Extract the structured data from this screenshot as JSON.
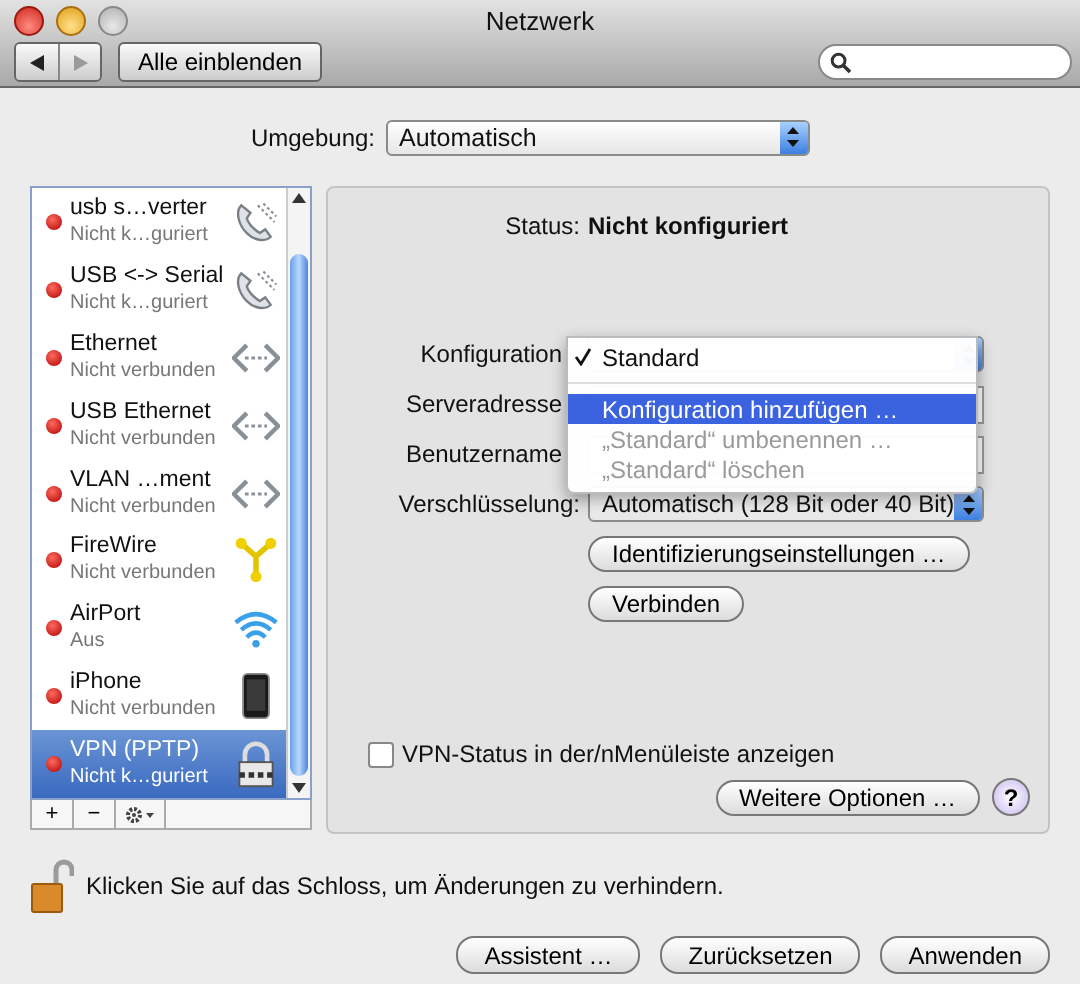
{
  "window": {
    "title": "Netzwerk"
  },
  "toolbar": {
    "show_all": "Alle einblenden",
    "back_disabled": false,
    "forward_disabled": true
  },
  "location": {
    "label": "Umgebung:",
    "value": "Automatisch"
  },
  "services": [
    {
      "name": "usb s…verter",
      "status": "Nicht k…guriert",
      "kind": "modem",
      "selected": false
    },
    {
      "name": "USB <-> Serial",
      "status": "Nicht k…guriert",
      "kind": "modem",
      "selected": false
    },
    {
      "name": "Ethernet",
      "status": "Nicht verbunden",
      "kind": "ethernet",
      "selected": false
    },
    {
      "name": "USB Ethernet",
      "status": "Nicht verbunden",
      "kind": "ethernet",
      "selected": false
    },
    {
      "name": "VLAN …ment",
      "status": "Nicht verbunden",
      "kind": "ethernet",
      "selected": false
    },
    {
      "name": "FireWire",
      "status": "Nicht verbunden",
      "kind": "firewire",
      "selected": false
    },
    {
      "name": "AirPort",
      "status": "Aus",
      "kind": "wireless",
      "selected": false
    },
    {
      "name": "iPhone",
      "status": "Nicht verbunden",
      "kind": "handset",
      "selected": false
    },
    {
      "name": "VPN (PPTP)",
      "status": "Nicht k…guriert",
      "kind": "vpn",
      "selected": true
    }
  ],
  "list_buttons": [
    "+",
    "−"
  ],
  "status": {
    "label": "Status:",
    "value": "Nicht konfiguriert"
  },
  "fields": [
    {
      "label": "Konfiguration",
      "kind": "popup"
    },
    {
      "label": "Serveradresse",
      "kind": "text"
    },
    {
      "label": "Benutzername",
      "kind": "text"
    },
    {
      "label": "Verschlüsselung:",
      "kind": "popup",
      "value": "Automatisch (128 Bit oder 40 Bit)"
    }
  ],
  "config_menu": [
    {
      "kind": "item",
      "label": "Standard",
      "checked": true,
      "selected": false,
      "disabled": false
    },
    {
      "kind": "separator"
    },
    {
      "kind": "item",
      "label": "Konfiguration hinzufügen …",
      "checked": false,
      "selected": true,
      "disabled": false
    },
    {
      "kind": "item",
      "label": "„Standard“ umbenennen …",
      "checked": false,
      "selected": false,
      "disabled": true
    },
    {
      "kind": "item",
      "label": "„Standard“ löschen",
      "checked": false,
      "selected": false,
      "disabled": true
    }
  ],
  "panel_buttons": [
    "Identifizierungseinstellungen …",
    "Verbinden"
  ],
  "menu_checkbox": {
    "label": "VPN-Status in der/nMenüleiste anzeigen",
    "checked": false
  },
  "more_options": "Weitere Optionen …",
  "help": "?",
  "lock_text": "Klicken Sie auf das Schloss, um Änderungen zu verhindern.",
  "footer_buttons": [
    "Assistent …",
    "Zurücksetzen",
    "Anwenden"
  ]
}
